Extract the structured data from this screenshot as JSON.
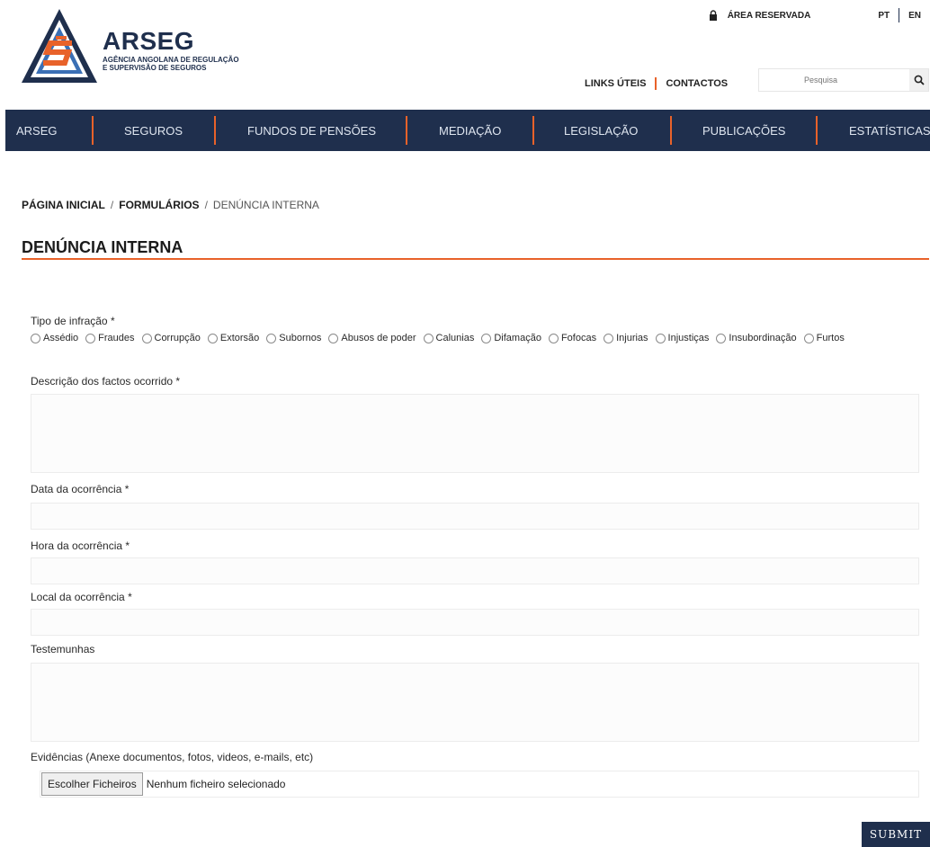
{
  "header": {
    "logo": {
      "title": "ARSEG",
      "subtitle_line1": "AGÊNCIA ANGOLANA DE REGULAÇÃO",
      "subtitle_line2": "E SUPERVISÃO DE SEGUROS"
    },
    "area_reservada": "ÁREA RESERVADA",
    "languages": [
      "PT",
      "EN"
    ],
    "links": [
      "LINKS ÚTEIS",
      "CONTACTOS"
    ],
    "search": {
      "placeholder": "Pesquisa",
      "button_icon": "search-icon"
    }
  },
  "nav": {
    "items": [
      "ARSEG",
      "SEGUROS",
      "FUNDOS DE PENSÕES",
      "MEDIAÇÃO",
      "LEGISLAÇÃO",
      "PUBLICAÇÕES",
      "ESTATÍSTICAS"
    ]
  },
  "breadcrumb": {
    "home": "PÁGINA INICIAL",
    "section": "FORMULÁRIOS",
    "current": "DENÚNCIA INTERNA",
    "separator": "/"
  },
  "page_title": "DENÚNCIA INTERNA",
  "form": {
    "infraction_label": "Tipo de infração *",
    "infraction_options": [
      "Assédio",
      "Fraudes",
      "Corrupção",
      "Extorsão",
      "Subornos",
      "Abusos de poder",
      "Calunias",
      "Difamação",
      "Fofocas",
      "Injurias",
      "Injustiças",
      "Insubordinação",
      "Furtos"
    ],
    "description_label": "Descrição dos factos ocorrido *",
    "date_label": "Data da ocorrência *",
    "time_label": "Hora da ocorrência *",
    "place_label": "Local da ocorrência *",
    "witnesses_label": "Testemunhas",
    "evidence_label": "Evidências (Anexe documentos, fotos, videos, e-mails, etc)",
    "file_button": "Escolher Ficheiros",
    "file_status": "Nenhum ficheiro selecionado",
    "submit": "SUBMIT"
  },
  "colors": {
    "brand_navy": "#1f2f4d",
    "accent_orange": "#e8622a"
  }
}
